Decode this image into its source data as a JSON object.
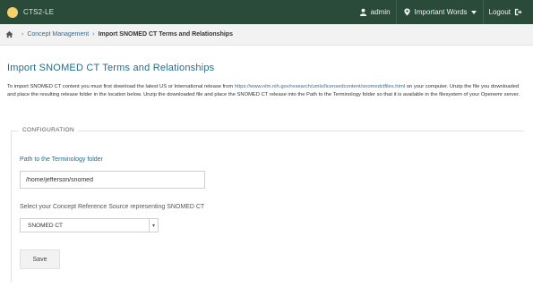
{
  "navbar": {
    "brand": "CTS2-LE",
    "admin_label": "admin",
    "workspace_label": "Important Words",
    "logout_label": "Logout",
    "bg_color": "#2a4a3a"
  },
  "breadcrumb": {
    "items": [
      "Concept Management",
      "Import SNOMED CT Terms and Relationships"
    ]
  },
  "page": {
    "title": "Import SNOMED CT Terms and Relationships",
    "intro_part1": "To import SNOMED CT content you must first download the latest US or International release from ",
    "intro_link": "https://www.nlm.nih.gov/research/umls/licensedcontent/snomedctfiles.html",
    "intro_part2": " on your computer. Unzip the file you downloaded and place the resulting release folder in the location below. Unzip the downloaded file and place the SNOMED CT release into the Path to the Terminology folder so that it is available in the filesystem of your Openemr server."
  },
  "form": {
    "legend": "CONFIGURATION",
    "path_label": "Path to the Terminology folder",
    "path_value": "/home/jefferson/snomed",
    "select_label": "Select your Concept Reference Source representing SNOMED CT",
    "select_value": "SNOMED CT",
    "save_label": "Save"
  }
}
